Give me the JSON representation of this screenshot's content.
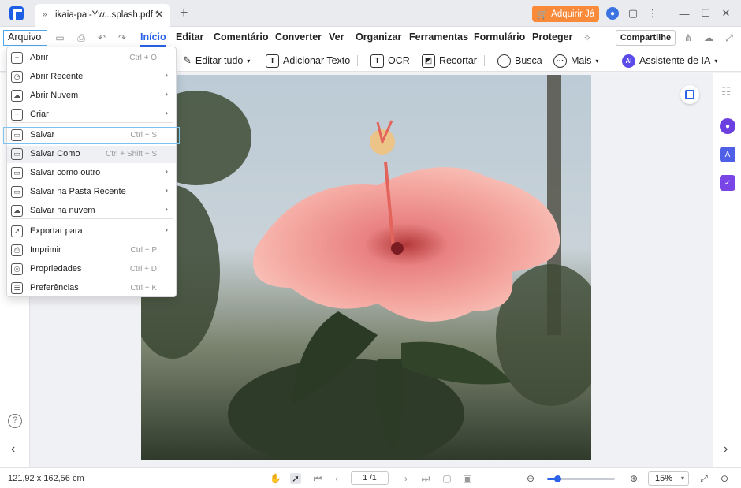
{
  "titlebar": {
    "tab_icon": "»",
    "tab_title": "ikaia-pal-Yw...splash.pdf *",
    "close_glyph": "✕",
    "new_tab_glyph": "+",
    "buy_label": "Adquirir Já",
    "avatar_glyph": "●",
    "chat_glyph": "▢",
    "more_glyph": "⋮",
    "min_glyph": "—",
    "max_glyph": "☐",
    "win_close_glyph": "✕"
  },
  "menubar": {
    "arquivo": "Arquivo",
    "tabs": [
      "Início",
      "Editar",
      "Comentário",
      "Converter",
      "Ver",
      "Organizar",
      "Ferramentas",
      "Formulário",
      "Proteger"
    ],
    "share": "Compartilhe"
  },
  "toolbar": {
    "edit_all": "Editar tudo",
    "add_text": "Adicionar Texto",
    "ocr": "OCR",
    "crop": "Recortar",
    "search": "Busca",
    "more": "Mais",
    "ai_assistant": "Assistente de IA",
    "ai_badge": "AI",
    "text_badge": "T"
  },
  "file_menu": {
    "items": [
      {
        "label": "Abrir",
        "shortcut": "Ctrl + O",
        "icon": "+"
      },
      {
        "label": "Abrir Recente",
        "shortcut": "",
        "icon": "◷",
        "arrow": "›"
      },
      {
        "label": "Abrir Nuvem",
        "shortcut": "",
        "icon": "☁",
        "arrow": "›"
      },
      {
        "label": "Criar",
        "shortcut": "",
        "icon": "+",
        "arrow": "›"
      },
      {
        "label": "Salvar",
        "shortcut": "Ctrl + S",
        "icon": "▭"
      },
      {
        "label": "Salvar Como",
        "shortcut": "Ctrl + Shift + S",
        "icon": "▭"
      },
      {
        "label": "Salvar como outro",
        "shortcut": "",
        "icon": "▭",
        "arrow": "›"
      },
      {
        "label": "Salvar na Pasta Recente",
        "shortcut": "",
        "icon": "▭",
        "arrow": "›"
      },
      {
        "label": "Salvar na nuvem",
        "shortcut": "",
        "icon": "☁",
        "arrow": "›"
      },
      {
        "label": "Exportar para",
        "shortcut": "",
        "icon": "↗",
        "arrow": "›"
      },
      {
        "label": "Imprimir",
        "shortcut": "Ctrl + P",
        "icon": "⎙"
      },
      {
        "label": "Propriedades",
        "shortcut": "Ctrl + D",
        "icon": "◎"
      },
      {
        "label": "Preferências",
        "shortcut": "Ctrl + K",
        "icon": "☰"
      }
    ]
  },
  "statusbar": {
    "dimensions": "121,92 x 162,56 cm",
    "page": "1 /1",
    "zoom": "15%",
    "zoom_fraction": 0.15
  },
  "left_rail": {
    "help_glyph": "?",
    "collapse_glyph": "‹"
  },
  "right_rail": {
    "expand_glyph": "›"
  },
  "colors": {
    "accent": "#2a62e8",
    "buy_button": "#f98a3a",
    "focus_outline": "#7ec2ee"
  }
}
